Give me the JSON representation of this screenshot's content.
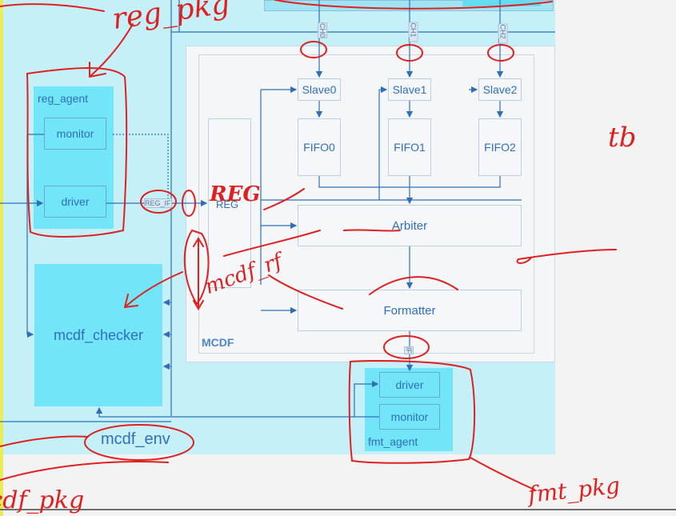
{
  "diagram": {
    "env_label": "mcdf_env",
    "dut_label": "MCDF",
    "reg_agent": {
      "title": "reg_agent",
      "monitor": "monitor",
      "driver": "driver"
    },
    "checker": "mcdf_checker",
    "fmt_agent": {
      "title": "fmt_agent",
      "driver": "driver",
      "monitor": "monitor"
    },
    "slaves": [
      "Slave0",
      "Slave1",
      "Slave2"
    ],
    "fifos": [
      "FIFO0",
      "FIFO1",
      "FIFO2"
    ],
    "arbiter": "Arbiter",
    "formatter": "Formatter",
    "reg_block": "REG",
    "channel_tags": [
      "CH0",
      "CH1_",
      "CH2_"
    ],
    "reg_if_tag": "REG_IF",
    "fmt_if_tag": "IF"
  },
  "annotations": {
    "reg_pkg": "reg_pkg",
    "tb": "tb",
    "reg": "REG",
    "mcdf_rf": "mcdf_rf",
    "fmt_pkg": "fmt_pkg",
    "mcdf_pkg": "mcdf_pkg"
  },
  "colors": {
    "env_bg": "#c5f0f8",
    "agent_bg": "#72e6f8",
    "line": "#2f6fb8",
    "annotation": "#e02020"
  }
}
